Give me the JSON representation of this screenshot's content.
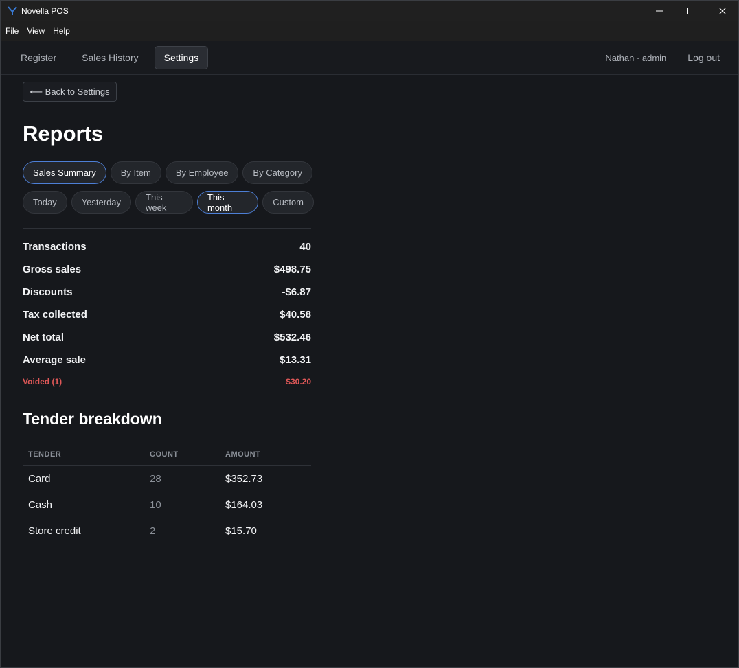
{
  "window": {
    "title": "Novella POS",
    "controls": [
      "minimize-icon",
      "maximize-icon",
      "close-icon"
    ]
  },
  "menubar": {
    "items": [
      {
        "label": "File"
      },
      {
        "label": "View"
      },
      {
        "label": "Help"
      }
    ]
  },
  "nav": {
    "tabs": [
      {
        "label": "Register",
        "active": false
      },
      {
        "label": "Sales History",
        "active": false
      },
      {
        "label": "Settings",
        "active": true
      }
    ],
    "user": "Nathan · admin",
    "logout_label": "Log out"
  },
  "page": {
    "back_label": "⟵ Back to Settings",
    "title": "Reports",
    "report_tabs": [
      {
        "label": "Sales Summary",
        "active": true
      },
      {
        "label": "By Item",
        "active": false
      },
      {
        "label": "By Employee",
        "active": false
      },
      {
        "label": "By Category",
        "active": false
      }
    ],
    "ranges": [
      {
        "label": "Today",
        "active": false
      },
      {
        "label": "Yesterday",
        "active": false
      },
      {
        "label": "This week",
        "active": false
      },
      {
        "label": "This month",
        "active": true
      },
      {
        "label": "Custom",
        "active": false
      }
    ],
    "stats": [
      {
        "label": "Transactions",
        "value": "40"
      },
      {
        "label": "Gross sales",
        "value": "$498.75"
      },
      {
        "label": "Discounts",
        "value": "-$6.87"
      },
      {
        "label": "Tax collected",
        "value": "$40.58"
      },
      {
        "label": "Net total",
        "value": "$532.46"
      },
      {
        "label": "Average sale",
        "value": "$13.31"
      }
    ],
    "voided": {
      "label": "Voided (1)",
      "value": "$30.20"
    },
    "tender_title": "Tender breakdown",
    "tender_headers": [
      "TENDER",
      "COUNT",
      "AMOUNT"
    ],
    "tender_rows": [
      {
        "tender": "Card",
        "count": "28",
        "amount": "$352.73"
      },
      {
        "tender": "Cash",
        "count": "10",
        "amount": "$164.03"
      },
      {
        "tender": "Store credit",
        "count": "2",
        "amount": "$15.70"
      }
    ]
  },
  "colors": {
    "background": "#16181c",
    "accent": "#4d7fd6",
    "void": "#e05858"
  }
}
